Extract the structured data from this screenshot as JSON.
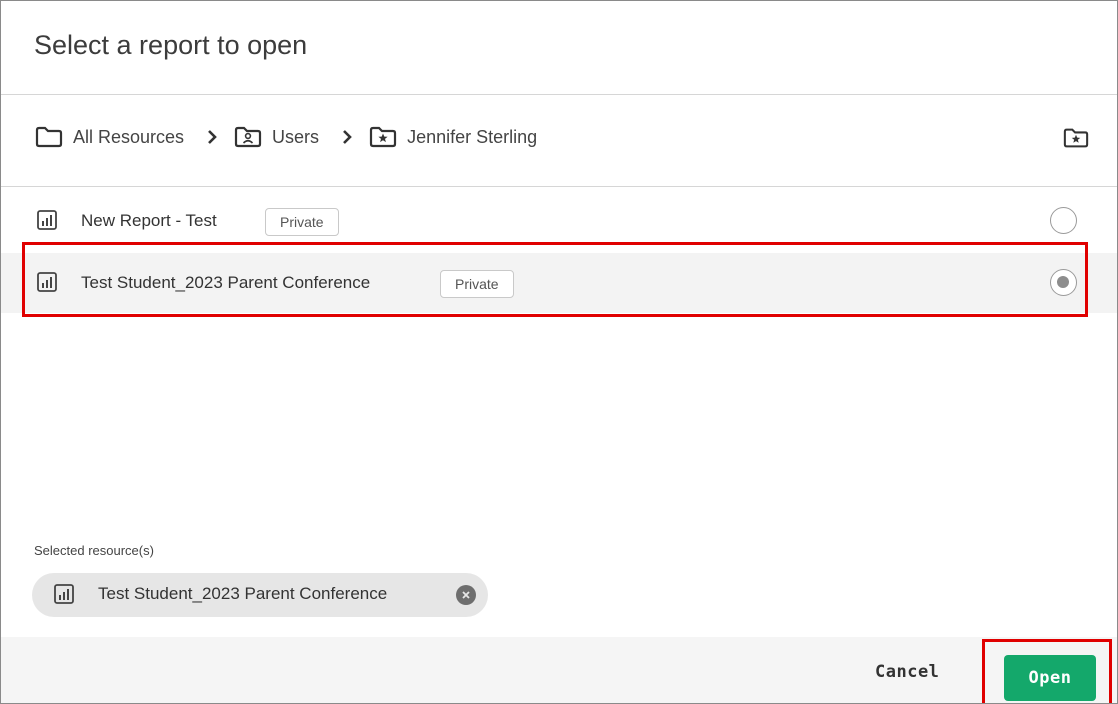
{
  "dialog": {
    "title": "Select a report to open"
  },
  "breadcrumb": {
    "items": [
      {
        "label": "All Resources",
        "icon": "folder-icon"
      },
      {
        "label": "Users",
        "icon": "user-folder-icon"
      },
      {
        "label": "Jennifer Sterling",
        "icon": "star-folder-icon"
      }
    ],
    "favorite_icon": "star-folder-icon"
  },
  "reports": [
    {
      "name": "New Report - Test",
      "badge": "Private",
      "icon": "report-chart-icon",
      "selected": false
    },
    {
      "name": "Test Student_2023 Parent Conference",
      "badge": "Private",
      "icon": "report-chart-icon",
      "selected": true
    }
  ],
  "selected_section": {
    "label": "Selected resource(s)",
    "chips": [
      {
        "label": "Test Student_2023 Parent Conference",
        "icon": "report-chart-icon"
      }
    ]
  },
  "footer": {
    "cancel_label": "Cancel",
    "open_label": "Open"
  },
  "colors": {
    "accent_green": "#14a86b",
    "highlight_red": "#e00000"
  }
}
